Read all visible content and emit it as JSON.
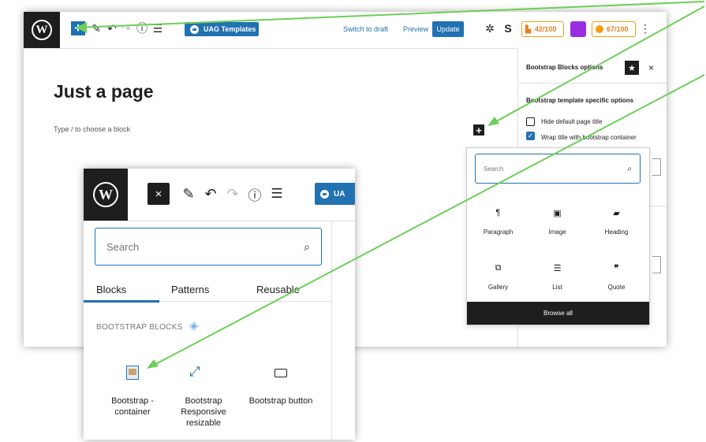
{
  "toolbar": {
    "uag_label": "UAG Templates",
    "switch_draft": "Switch to draft",
    "preview": "Preview",
    "update": "Update",
    "score1": "42/100",
    "score2": "67/100"
  },
  "editor": {
    "title": "Just a page",
    "hint": "Type / to choose a block"
  },
  "sidebar": {
    "header": "Bootstrap Blocks options",
    "section": "Bootstrap template specific options",
    "options": [
      {
        "label": "Hide default page title",
        "checked": false
      },
      {
        "label": "Wrap title with bootstrap container",
        "checked": true
      }
    ]
  },
  "popup": {
    "search_placeholder": "Search",
    "blocks": [
      {
        "label": "Paragraph",
        "icon": "paragraph-icon"
      },
      {
        "label": "Image",
        "icon": "image-icon"
      },
      {
        "label": "Heading",
        "icon": "heading-icon"
      },
      {
        "label": "Gallery",
        "icon": "gallery-icon"
      },
      {
        "label": "List",
        "icon": "list-icon"
      },
      {
        "label": "Quote",
        "icon": "quote-icon"
      }
    ],
    "browse_all": "Browse all"
  },
  "inset": {
    "uag_partial": "UA",
    "search_placeholder": "Search",
    "tabs": [
      "Blocks",
      "Patterns",
      "Reusable"
    ],
    "section": "BOOTSTRAP BLOCKS",
    "blocks": [
      {
        "label": "Bootstrap - container",
        "icon": "container-icon"
      },
      {
        "label": "Bootstrap Responsive resizable",
        "icon": "resize-icon"
      },
      {
        "label": "Bootstrap button",
        "icon": "button-icon"
      }
    ]
  },
  "colors": {
    "accent": "#2271b1",
    "arrow": "#6ccf59",
    "dark": "#1e1e1e"
  }
}
